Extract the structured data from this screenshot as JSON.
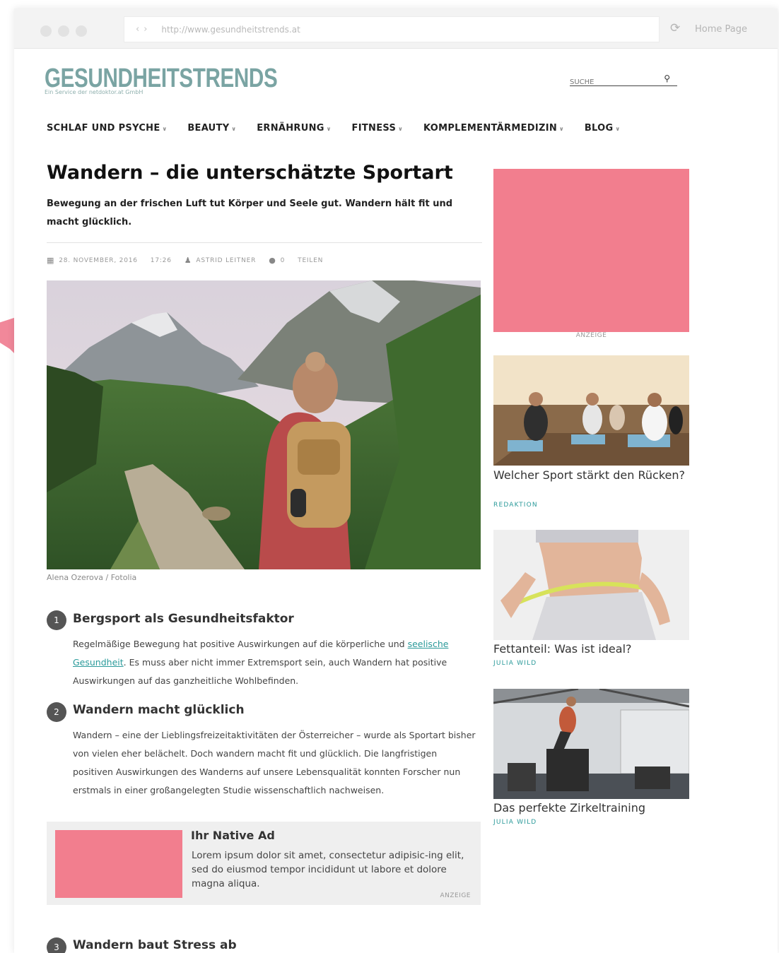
{
  "browser": {
    "url": "http://www.gesundheitstrends.at",
    "home_label": "Home Page"
  },
  "site": {
    "logo": "GESUNDHEITSTRENDS",
    "tagline": "Ein Service der netdoktor.at GmbH",
    "search_placeholder": "SUCHE"
  },
  "nav": [
    {
      "label": "SCHLAF UND PSYCHE"
    },
    {
      "label": "BEAUTY"
    },
    {
      "label": "ERNÄHRUNG"
    },
    {
      "label": "FITNESS"
    },
    {
      "label": "KOMPLEMENTÄRMEDIZIN"
    },
    {
      "label": "BLOG"
    }
  ],
  "article": {
    "title": "Wandern – die unterschätzte Sportart",
    "lead": "Bewegung an der frischen Luft tut Körper und Seele gut. Wandern hält fit und macht glücklich.",
    "date": "28. NOVEMBER, 2016",
    "time": "17:26",
    "author": "ASTRID LEITNER",
    "comments": "0",
    "share": "TEILEN",
    "image_caption": "Alena Ozerova / Fotolia",
    "sections": [
      {
        "num": "1",
        "heading": "Bergsport als Gesundheitsfaktor",
        "text_before": "Regelmäßige Bewegung hat positive Auswirkungen auf die körperliche und ",
        "link": "seelische Gesundheit",
        "text_after": ". Es muss aber nicht immer Extremsport sein, auch Wandern hat positive Auswirkungen auf das ganzheitliche Wohlbefinden."
      },
      {
        "num": "2",
        "heading": "Wandern macht glücklich",
        "text": "Wandern – eine der Lieblingsfreizeitaktivitäten der Österreicher – wurde als Sportart bisher von vielen eher belächelt. Doch wandern macht fit und glücklich. Die langfristigen positiven Auswirkungen des Wanderns auf unsere Lebensqualität konnten Forscher nun erstmals in einer großangelegten Studie wissenschaftlich nachweisen."
      },
      {
        "num": "3",
        "heading": "Wandern baut Stress ab"
      }
    ]
  },
  "native_ad": {
    "heading": "Ihr Native Ad",
    "text": "Lorem ipsum dolor sit amet, consectetur adipisic-ing elit, sed do eiusmod tempor incididunt ut labore et dolore magna aliqua.",
    "label": "ANZEIGE"
  },
  "sidebar": {
    "ad_label": "ANZEIGE",
    "cards": [
      {
        "title": "Welcher Sport stärkt den Rücken?",
        "author": "REDAKTION"
      },
      {
        "title": "Fettanteil: Was ist ideal?",
        "author": "JULIA WILD"
      },
      {
        "title": "Das perfekte Zirkeltraining",
        "author": "JULIA WILD"
      }
    ]
  },
  "colors": {
    "brand_teal": "#7aa4a3",
    "ad_pink": "#f27e8e",
    "link": "#2b9a9a"
  }
}
